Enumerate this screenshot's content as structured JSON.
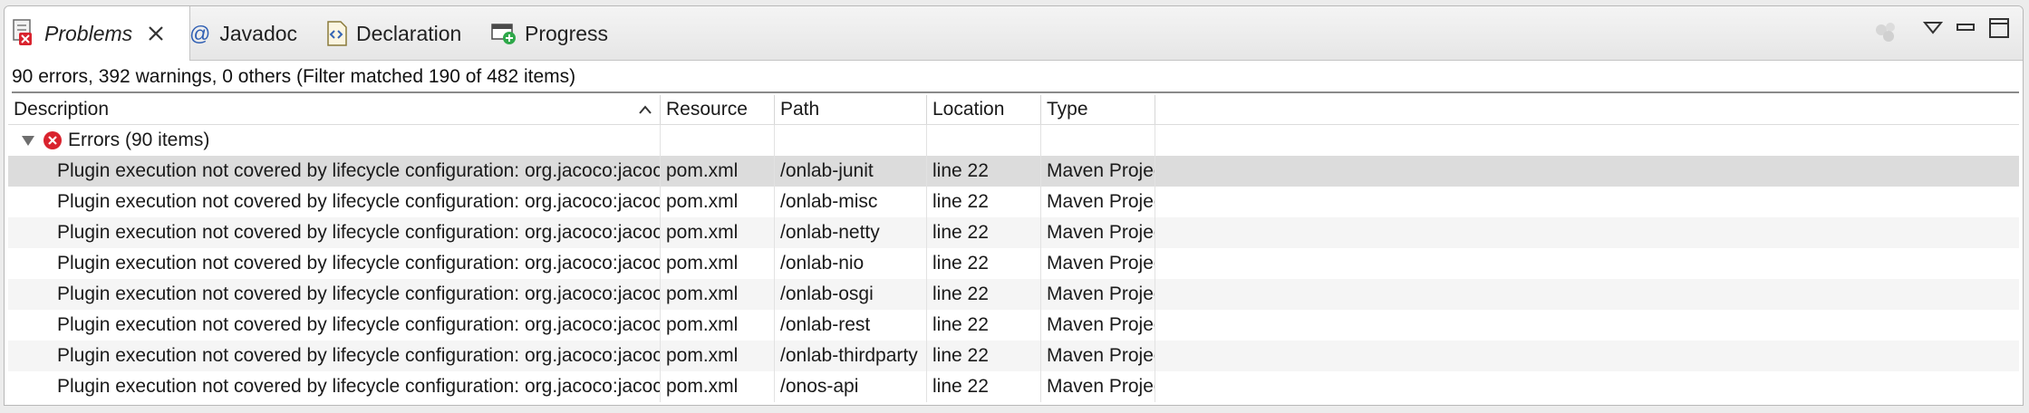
{
  "tabs": [
    {
      "label": "Problems",
      "icon": "problems-icon",
      "active": true
    },
    {
      "label": "Javadoc",
      "icon": "at-sign-icon"
    },
    {
      "label": "Declaration",
      "icon": "declaration-icon"
    },
    {
      "label": "Progress",
      "icon": "progress-icon"
    }
  ],
  "summary": "90 errors, 392 warnings, 0 others (Filter matched 190 of 482 items)",
  "columns": {
    "description": "Description",
    "resource": "Resource",
    "path": "Path",
    "location": "Location",
    "type": "Type"
  },
  "group": {
    "label": "Errors (90 items)",
    "icon": "error-icon",
    "expanded": true
  },
  "rows": [
    {
      "description": "Plugin execution not covered by lifecycle configuration: org.jacoco:jacoco-maven-pl...",
      "resource": "pom.xml",
      "path": "/onlab-junit",
      "location": "line 22",
      "type": "Maven Projec..."
    },
    {
      "description": "Plugin execution not covered by lifecycle configuration: org.jacoco:jacoco-maven-pl...",
      "resource": "pom.xml",
      "path": "/onlab-misc",
      "location": "line 22",
      "type": "Maven Projec..."
    },
    {
      "description": "Plugin execution not covered by lifecycle configuration: org.jacoco:jacoco-maven-pl...",
      "resource": "pom.xml",
      "path": "/onlab-netty",
      "location": "line 22",
      "type": "Maven Projec..."
    },
    {
      "description": "Plugin execution not covered by lifecycle configuration: org.jacoco:jacoco-maven-pl...",
      "resource": "pom.xml",
      "path": "/onlab-nio",
      "location": "line 22",
      "type": "Maven Projec..."
    },
    {
      "description": "Plugin execution not covered by lifecycle configuration: org.jacoco:jacoco-maven-pl...",
      "resource": "pom.xml",
      "path": "/onlab-osgi",
      "location": "line 22",
      "type": "Maven Projec..."
    },
    {
      "description": "Plugin execution not covered by lifecycle configuration: org.jacoco:jacoco-maven-pl...",
      "resource": "pom.xml",
      "path": "/onlab-rest",
      "location": "line 22",
      "type": "Maven Projec..."
    },
    {
      "description": "Plugin execution not covered by lifecycle configuration: org.jacoco:jacoco-maven-pl...",
      "resource": "pom.xml",
      "path": "/onlab-thirdparty",
      "location": "line 22",
      "type": "Maven Projec..."
    },
    {
      "description": "Plugin execution not covered by lifecycle configuration: org.jacoco:jacoco-maven-pl...",
      "resource": "pom.xml",
      "path": "/onos-api",
      "location": "line 22",
      "type": "Maven Projec..."
    }
  ],
  "view_tools": [
    "busy-indicator-icon",
    "view-menu-icon",
    "minimize-icon",
    "maximize-icon"
  ]
}
